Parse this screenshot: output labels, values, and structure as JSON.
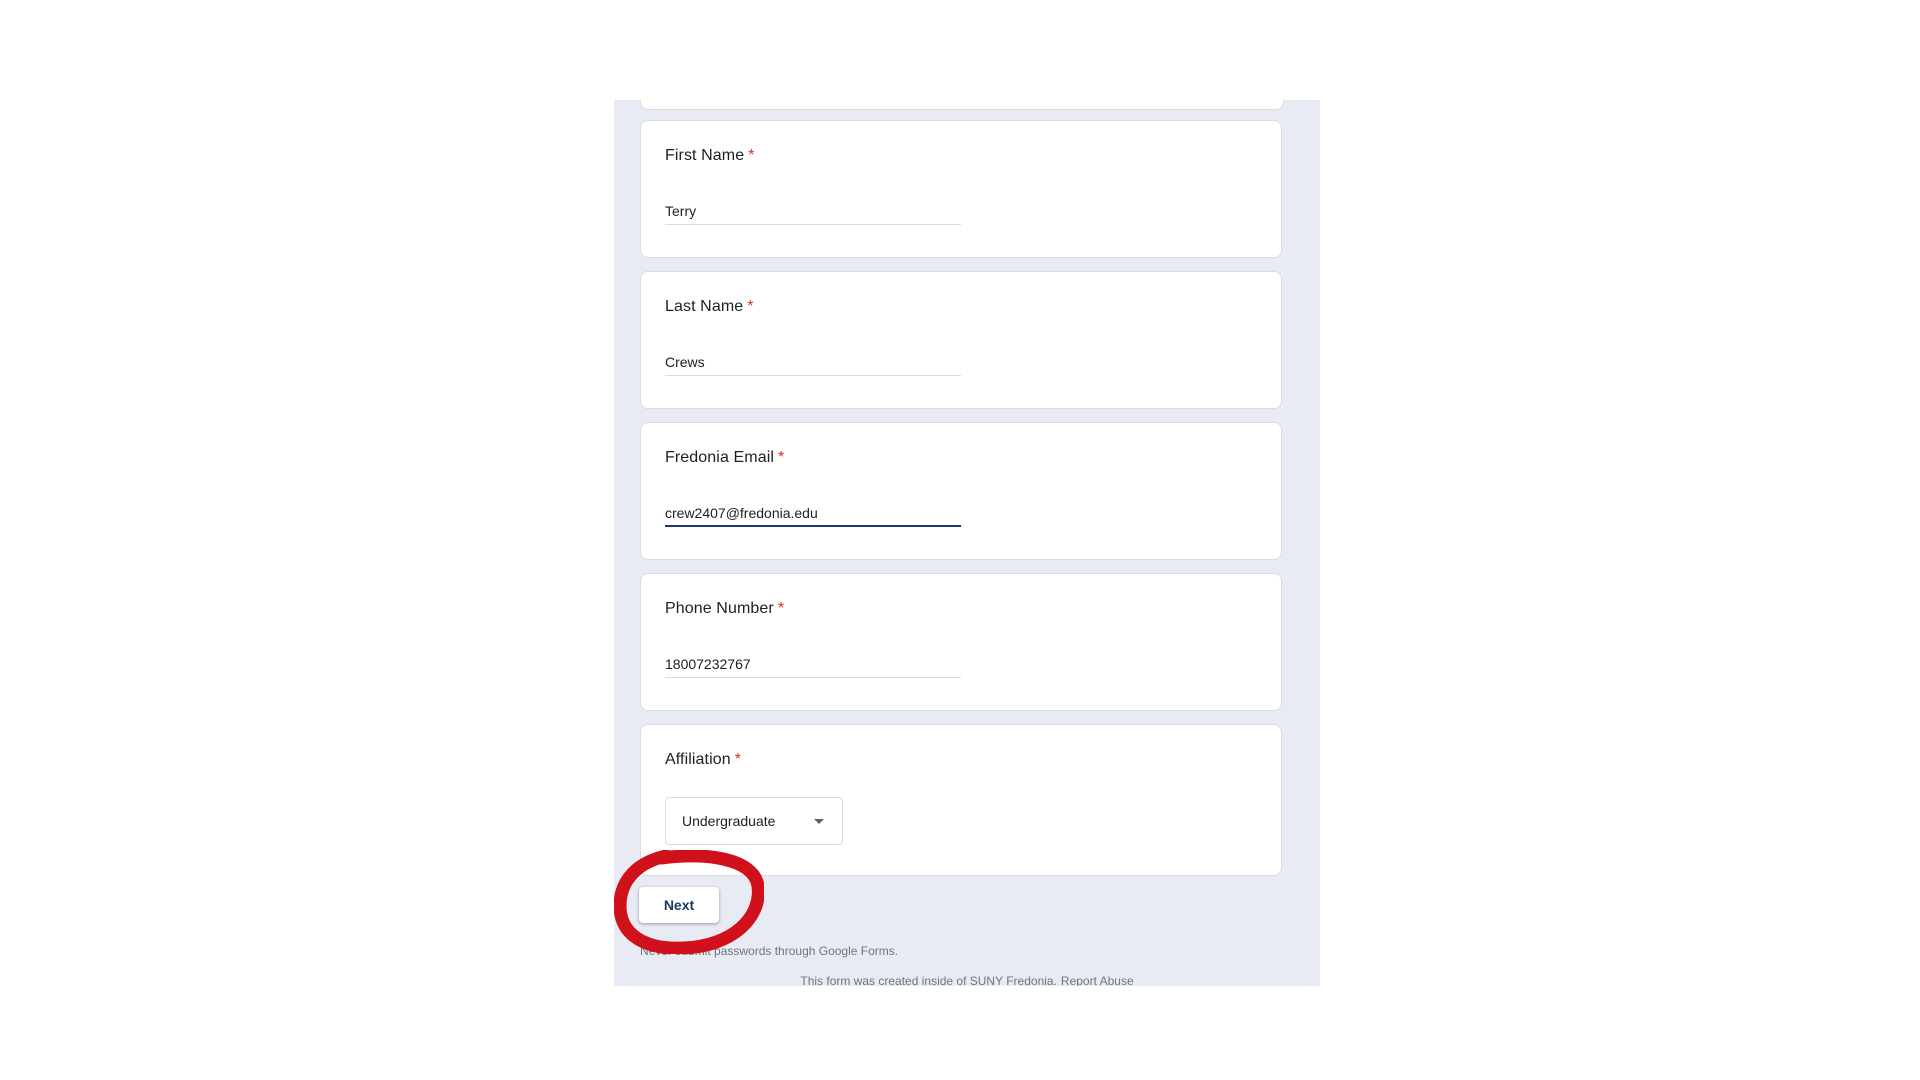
{
  "questions": [
    {
      "title": "First Name",
      "required_mark": "*",
      "value": "Terry"
    },
    {
      "title": "Last Name",
      "required_mark": "*",
      "value": "Crews"
    },
    {
      "title": "Fredonia Email",
      "required_mark": "*",
      "value": "crew2407@fredonia.edu"
    },
    {
      "title": "Phone Number",
      "required_mark": "*",
      "value": "18007232767"
    },
    {
      "title": "Affiliation",
      "required_mark": "*",
      "selected_option": "Undergraduate"
    }
  ],
  "next_label": "Next",
  "footer": {
    "password_note": "Never submit passwords through Google Forms.",
    "created_text": "This form was created inside of SUNY Fredonia.",
    "report_link": "Report Abuse"
  },
  "colors": {
    "page_bg": "#e8ebf4",
    "accent": "#1a3a66",
    "required": "#d93025",
    "annotation": "#d0111b"
  }
}
